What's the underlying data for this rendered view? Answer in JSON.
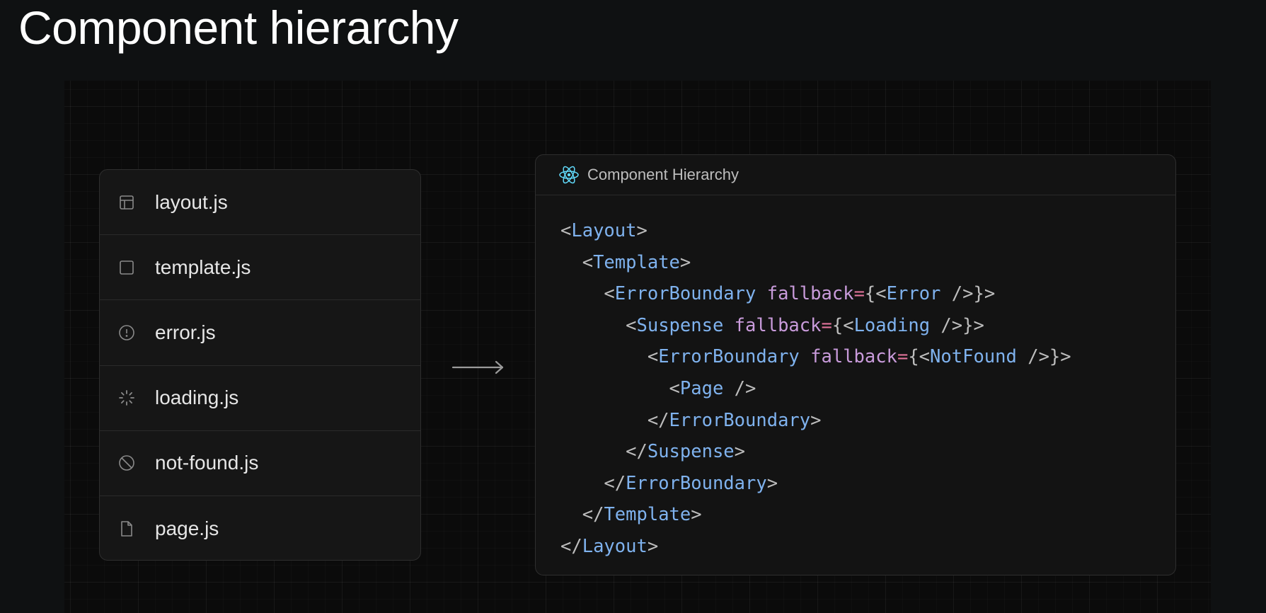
{
  "page": {
    "title": "Component hierarchy"
  },
  "files": [
    {
      "label": "layout.js",
      "icon": "layout-icon"
    },
    {
      "label": "template.js",
      "icon": "square-icon"
    },
    {
      "label": "error.js",
      "icon": "alert-circle-icon"
    },
    {
      "label": "loading.js",
      "icon": "spinner-icon"
    },
    {
      "label": "not-found.js",
      "icon": "ban-icon"
    },
    {
      "label": "page.js",
      "icon": "file-icon"
    }
  ],
  "code_panel": {
    "title": "Component Hierarchy",
    "icon": "react-icon",
    "lines": [
      {
        "indent": "",
        "tokens": [
          {
            "t": "<",
            "k": "punct"
          },
          {
            "t": "Layout",
            "k": "tag"
          },
          {
            "t": ">",
            "k": "punct"
          }
        ]
      },
      {
        "indent": "  ",
        "tokens": [
          {
            "t": "<",
            "k": "punct"
          },
          {
            "t": "Template",
            "k": "tag"
          },
          {
            "t": ">",
            "k": "punct"
          }
        ]
      },
      {
        "indent": "    ",
        "tokens": [
          {
            "t": "<",
            "k": "punct"
          },
          {
            "t": "ErrorBoundary",
            "k": "tag"
          },
          {
            "t": " ",
            "k": "punct"
          },
          {
            "t": "fallback",
            "k": "attr"
          },
          {
            "t": "=",
            "k": "eq"
          },
          {
            "t": "{<",
            "k": "punct"
          },
          {
            "t": "Error",
            "k": "tag"
          },
          {
            "t": " />}>",
            "k": "punct"
          }
        ]
      },
      {
        "indent": "      ",
        "tokens": [
          {
            "t": "<",
            "k": "punct"
          },
          {
            "t": "Suspense",
            "k": "tag"
          },
          {
            "t": " ",
            "k": "punct"
          },
          {
            "t": "fallback",
            "k": "attr"
          },
          {
            "t": "=",
            "k": "eq"
          },
          {
            "t": "{<",
            "k": "punct"
          },
          {
            "t": "Loading",
            "k": "tag"
          },
          {
            "t": " />}>",
            "k": "punct"
          }
        ]
      },
      {
        "indent": "        ",
        "tokens": [
          {
            "t": "<",
            "k": "punct"
          },
          {
            "t": "ErrorBoundary",
            "k": "tag"
          },
          {
            "t": " ",
            "k": "punct"
          },
          {
            "t": "fallback",
            "k": "attr"
          },
          {
            "t": "=",
            "k": "eq"
          },
          {
            "t": "{<",
            "k": "punct"
          },
          {
            "t": "NotFound",
            "k": "tag"
          },
          {
            "t": " />}>",
            "k": "punct"
          }
        ]
      },
      {
        "indent": "          ",
        "tokens": [
          {
            "t": "<",
            "k": "punct"
          },
          {
            "t": "Page",
            "k": "tag"
          },
          {
            "t": " />",
            "k": "punct"
          }
        ]
      },
      {
        "indent": "        ",
        "tokens": [
          {
            "t": "</",
            "k": "punct"
          },
          {
            "t": "ErrorBoundary",
            "k": "tag"
          },
          {
            "t": ">",
            "k": "punct"
          }
        ]
      },
      {
        "indent": "      ",
        "tokens": [
          {
            "t": "</",
            "k": "punct"
          },
          {
            "t": "Suspense",
            "k": "tag"
          },
          {
            "t": ">",
            "k": "punct"
          }
        ]
      },
      {
        "indent": "    ",
        "tokens": [
          {
            "t": "</",
            "k": "punct"
          },
          {
            "t": "ErrorBoundary",
            "k": "tag"
          },
          {
            "t": ">",
            "k": "punct"
          }
        ]
      },
      {
        "indent": "  ",
        "tokens": [
          {
            "t": "</",
            "k": "punct"
          },
          {
            "t": "Template",
            "k": "tag"
          },
          {
            "t": ">",
            "k": "punct"
          }
        ]
      },
      {
        "indent": "",
        "tokens": [
          {
            "t": "</",
            "k": "punct"
          },
          {
            "t": "Layout",
            "k": "tag"
          },
          {
            "t": ">",
            "k": "punct"
          }
        ]
      }
    ]
  },
  "colors": {
    "background": "#0f1112",
    "tag": "#7fb2ee",
    "attr": "#c99bdb",
    "equals": "#e0739a",
    "punctuation": "#bdbdbd",
    "react_icon": "#61dafb"
  }
}
